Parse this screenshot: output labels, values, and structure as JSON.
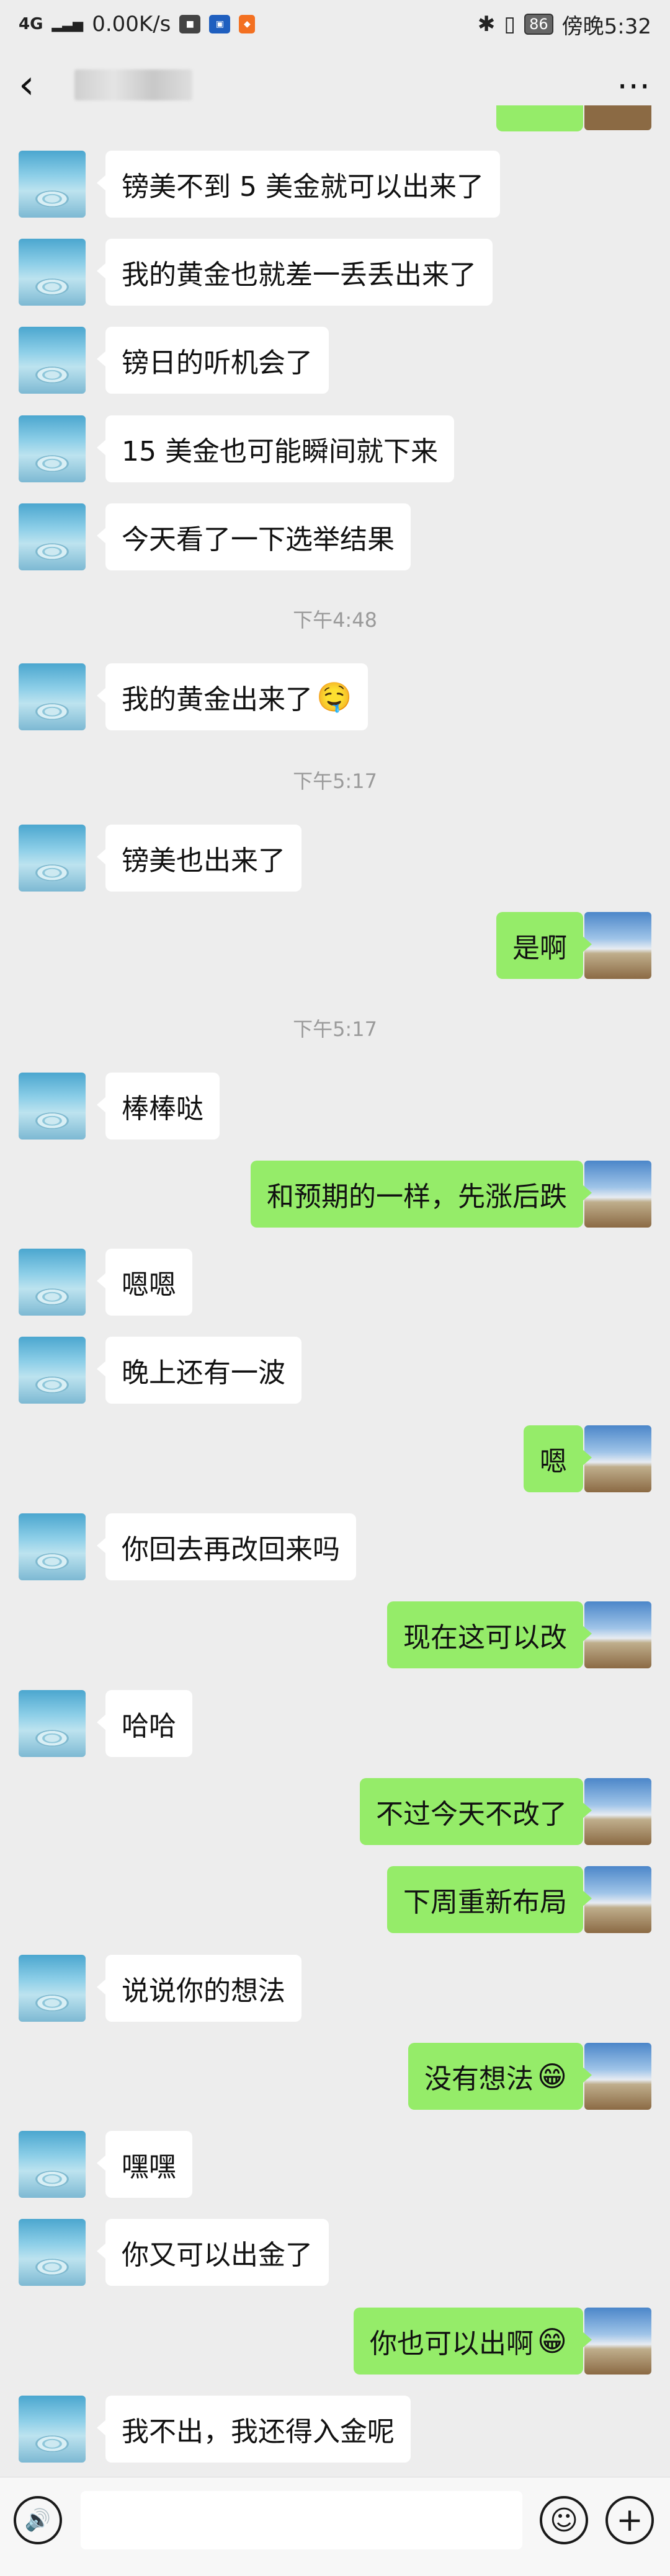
{
  "status_bar": {
    "network": "4G",
    "speed": "0.00K/s",
    "battery": "86",
    "time": "傍晚5:32",
    "icons": [
      "signal-icon",
      "briefcase-icon",
      "app-icon",
      "notification-icon",
      "bluetooth-icon",
      "vibrate-icon",
      "battery-icon"
    ]
  },
  "nav": {
    "back_icon": "‹",
    "more_icon": "⋯"
  },
  "messages": [
    {
      "side": "other",
      "text": "镑美不到 5 美金就可以出来了"
    },
    {
      "side": "other",
      "text": "我的黄金也就差一丢丢出来了"
    },
    {
      "side": "other",
      "text": "镑日的听机会了"
    },
    {
      "side": "other",
      "text": "15 美金也可能瞬间就下来"
    },
    {
      "side": "other",
      "text": "今天看了一下选举结果"
    },
    {
      "side": "time",
      "text": "下午4:48"
    },
    {
      "side": "other",
      "text": "我的黄金出来了",
      "emoji": "🤤"
    },
    {
      "side": "time",
      "text": "下午5:17"
    },
    {
      "side": "other",
      "text": "镑美也出来了"
    },
    {
      "side": "self",
      "text": "是啊"
    },
    {
      "side": "time",
      "text": "下午5:17"
    },
    {
      "side": "other",
      "text": "棒棒哒"
    },
    {
      "side": "self",
      "text": "和预期的一样，先涨后跌"
    },
    {
      "side": "other",
      "text": "嗯嗯"
    },
    {
      "side": "other",
      "text": "晚上还有一波"
    },
    {
      "side": "self",
      "text": "嗯"
    },
    {
      "side": "other",
      "text": "你回去再改回来吗"
    },
    {
      "side": "self",
      "text": "现在这可以改"
    },
    {
      "side": "other",
      "text": "哈哈"
    },
    {
      "side": "self",
      "text": "不过今天不改了"
    },
    {
      "side": "self",
      "text": "下周重新布局"
    },
    {
      "side": "other",
      "text": "说说你的想法"
    },
    {
      "side": "self",
      "text": "没有想法",
      "emoji": "😁"
    },
    {
      "side": "other",
      "text": "嘿嘿"
    },
    {
      "side": "other",
      "text": "你又可以出金了"
    },
    {
      "side": "self",
      "text": "你也可以出啊",
      "emoji": "😁"
    },
    {
      "side": "other",
      "text": "我不出，我还得入金呢"
    }
  ],
  "input_bar": {
    "voice_icon": "🔊",
    "emoji_icon": "☺",
    "plus_icon": "+"
  }
}
